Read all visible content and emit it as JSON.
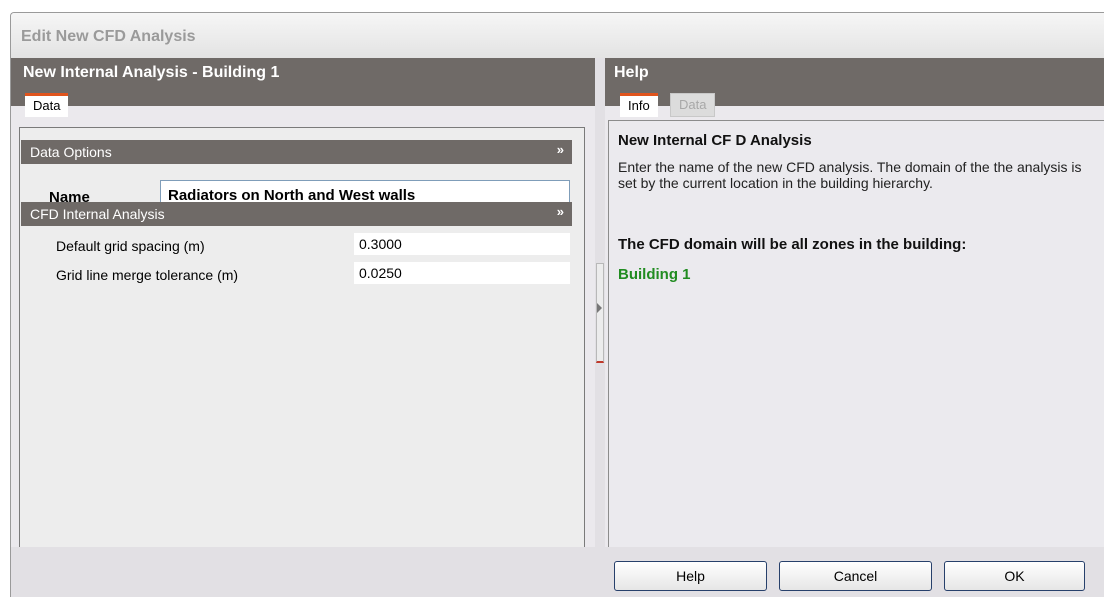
{
  "window": {
    "title": "Edit New CFD Analysis"
  },
  "left": {
    "header": "New Internal Analysis - Building 1",
    "tabs": [
      {
        "label": "Data",
        "active": true
      }
    ],
    "sections": [
      {
        "title": "Data Options",
        "collapse_icon": "double-chevron-up-icon"
      },
      {
        "title": "CFD Internal Analysis",
        "collapse_icon": "double-chevron-up-icon"
      }
    ],
    "name_label": "Name",
    "name_value": "Radiators on North and West walls",
    "properties": [
      {
        "label": "Default grid spacing (m)",
        "value": "0.3000"
      },
      {
        "label": "Grid line merge tolerance (m)",
        "value": "0.0250"
      }
    ]
  },
  "help": {
    "header": "Help",
    "tabs": [
      {
        "label": "Info",
        "active": true
      },
      {
        "label": "Data",
        "active": false
      }
    ],
    "title": "New Internal CF D Analysis",
    "body": "Enter the name of the new CFD analysis. The domain of the the analysis is set by the current location in the building hierarchy.",
    "domain_heading": "The CFD domain will be all zones in the building:",
    "domain_value": "Building 1"
  },
  "buttons": {
    "help": "Help",
    "cancel": "Cancel",
    "ok": "OK"
  },
  "colors": {
    "accent": "#e0541d",
    "header_bg": "#6f6a67",
    "domain_value": "#218c21"
  }
}
